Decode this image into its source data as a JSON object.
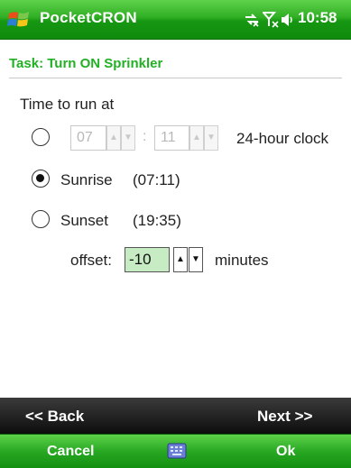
{
  "window": {
    "title": "PocketCRON",
    "clock": "10:58",
    "status_icons": [
      "connectivity-icon",
      "no-signal-icon",
      "volume-icon"
    ]
  },
  "task": {
    "header": "Task: Turn ON Sprinkler"
  },
  "form": {
    "section_label": "Time to run at",
    "options": [
      {
        "id": "custom",
        "selected": false,
        "hour": "07",
        "minute": "11",
        "suffix": "24-hour clock",
        "colon": ":"
      },
      {
        "id": "sunrise",
        "selected": true,
        "label": "Sunrise",
        "time": "(07:11)"
      },
      {
        "id": "sunset",
        "selected": false,
        "label": "Sunset",
        "time": "(19:35)"
      }
    ],
    "offset_label": "offset:",
    "offset_value": "-10",
    "offset_unit": "minutes"
  },
  "nav": {
    "back": "<< Back",
    "next": "Next >>"
  },
  "softkeys": {
    "left": "Cancel",
    "right": "Ok"
  },
  "colors": {
    "title_bar": "#2fae24",
    "task_header": "#22b024",
    "offset_field_bg": "#c7ecc4",
    "nav_bar": "#1a1a1a"
  }
}
